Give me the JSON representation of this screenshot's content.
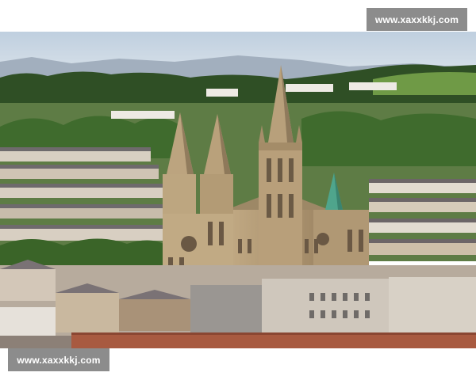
{
  "watermarks": {
    "top_right": "www.xaxxkkj.com",
    "bottom_left": "www.xaxxkkj.com"
  },
  "photo": {
    "subject": "gothic-cathedral-cityscape",
    "colors": {
      "sky": "#c9d6e2",
      "hills": "#9aa8b8",
      "trees": "#3e6a2c",
      "stone": "#b49c78",
      "stone_shadow": "#8a7558",
      "roof_green": "#4fa58c",
      "roof_tile": "#a85a40"
    }
  }
}
